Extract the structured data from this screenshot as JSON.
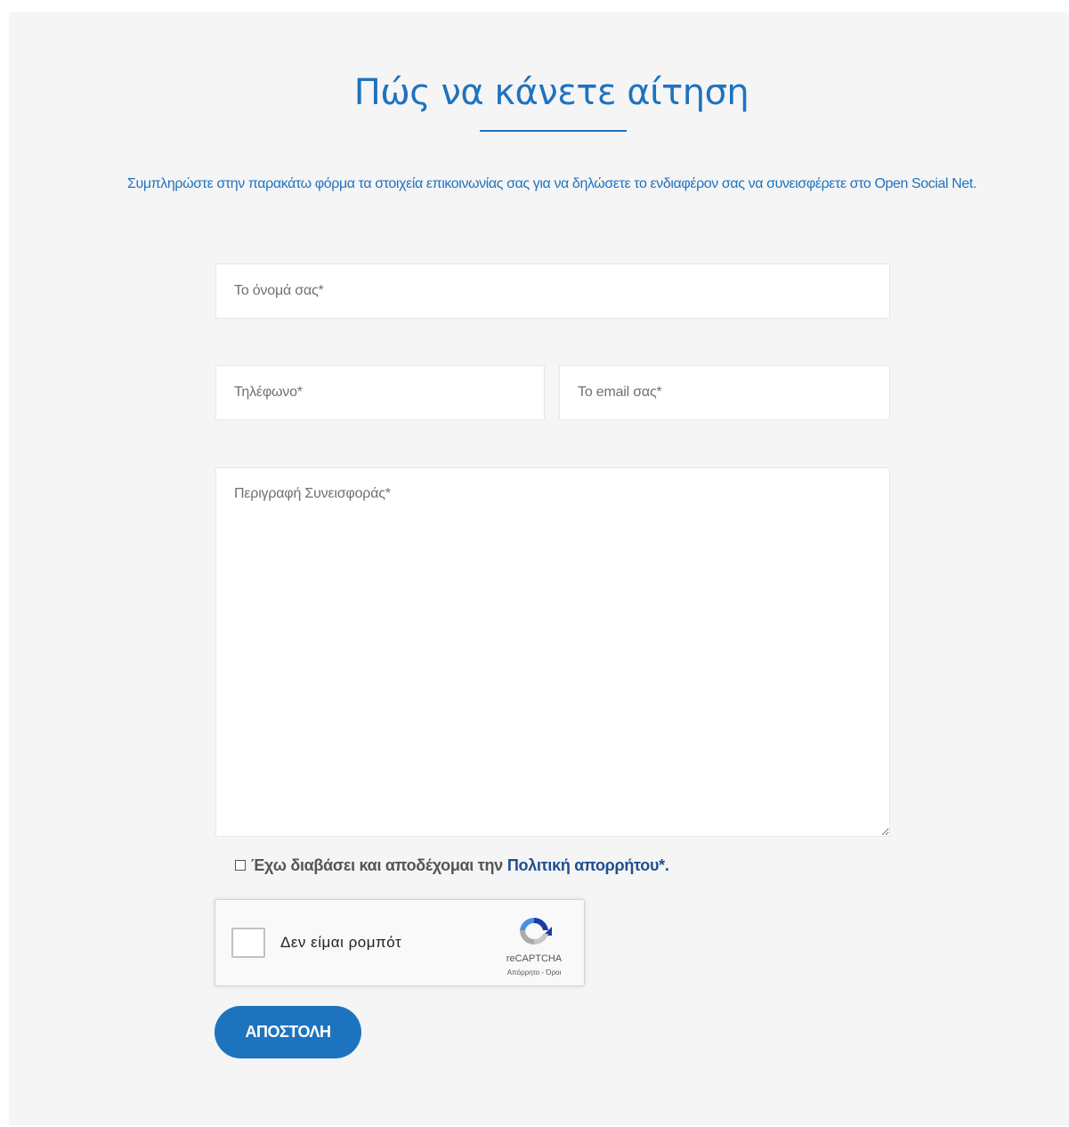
{
  "header": {
    "title": "Πώς να κάνετε αίτηση",
    "subtitle": "Συμπληρώστε στην παρακάτω φόρμα τα στοιχεία επικοινωνίας σας για να δηλώσετε το ενδιαφέρον σας να συνεισφέρετε στο Open Social Net."
  },
  "form": {
    "name_placeholder": "Το όνομά σας*",
    "phone_placeholder": "Τηλέφωνο*",
    "email_placeholder": "Το email σας*",
    "description_placeholder": "Περιγραφή Συνεισφοράς*",
    "consent_text": "Έχω διαβάσει και αποδέχομαι την",
    "consent_link": "Πολιτική απορρήτου*.",
    "submit_label": "ΑΠΟΣΤΟΛΗ"
  },
  "recaptcha": {
    "label": "Δεν είμαι ρομπότ",
    "brand": "reCAPTCHA",
    "terms": "Απόρρητο - Όροι",
    "logo_icon": "recaptcha-logo-icon"
  },
  "colors": {
    "accent": "#1e73be",
    "link": "#1f4f8f",
    "panel_bg": "#f5f5f6"
  }
}
